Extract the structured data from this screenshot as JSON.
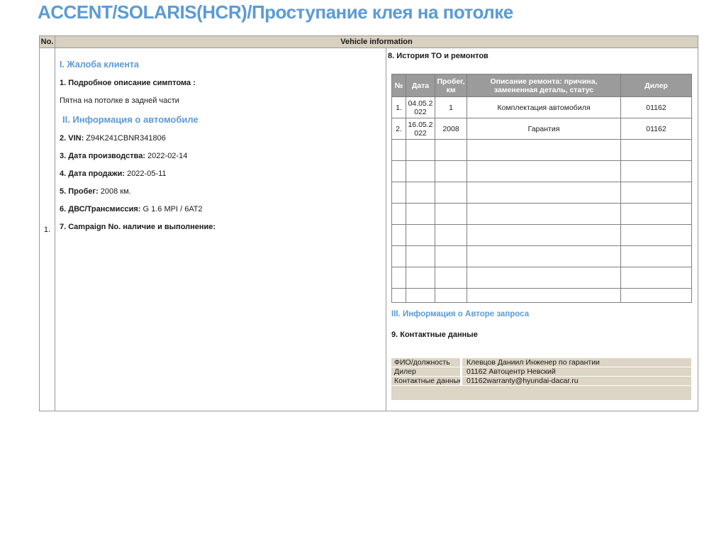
{
  "title": "ACCENT/SOLARIS(HCR)/Проступание клея на потолке",
  "colors": {
    "accent_blue": "#5b9bd5",
    "header_tan": "#d8d0c0",
    "table_header_gray": "#9b9b9b",
    "contact_tan": "#ddd5c5"
  },
  "report": {
    "no_header": "No.",
    "info_header": "Vehicle information",
    "row_number": "1."
  },
  "complaint": {
    "section_title": "I. Жалоба клиента",
    "symptom_label": "1. Подробное описание симптома :",
    "symptom_text": "Пятна на потолке в задней части"
  },
  "vehicle": {
    "section_title": "II. Информация о автомобиле",
    "fields": [
      {
        "label": "2. VIN:",
        "value": "Z94K241CBNR341806"
      },
      {
        "label": "3. Дата производства:",
        "value": "2022-02-14"
      },
      {
        "label": "4. Дата продажи:",
        "value": "2022-05-11"
      },
      {
        "label": "5. Пробег:",
        "value": "2008 км."
      },
      {
        "label": "6. ДВС/Трансмиссия:",
        "value": "G 1.6 MPI / 6АТ2"
      },
      {
        "label": "7. Campaign No. наличие и выполнение:",
        "value": ""
      }
    ]
  },
  "history": {
    "section_title": "8. История ТО и ремонтов",
    "columns": [
      "№",
      "Дата",
      "Пробег, км",
      "Описание ремонта: причина, замененная деталь, статус",
      "Дилер"
    ],
    "rows": [
      [
        "1.",
        "04.05.2022",
        "1",
        "Комплектация автомобиля",
        "01162"
      ],
      [
        "2.",
        "16.05.2022",
        "2008",
        "Гарантия",
        "01162"
      ]
    ],
    "empty_row_count": 8
  },
  "author": {
    "section_title": "III. Информация о Авторе запроса",
    "contacts_label": "9. Контактные данные",
    "contacts": [
      {
        "label": "ФИО/должность",
        "value": "Клевцов Даниил Инженер по гарантии"
      },
      {
        "label": "Дилер",
        "value": "01162 Автоцентр Невский"
      },
      {
        "label": "Контактные данные",
        "value": "01162warranty@hyundai-dacar.ru"
      }
    ]
  }
}
